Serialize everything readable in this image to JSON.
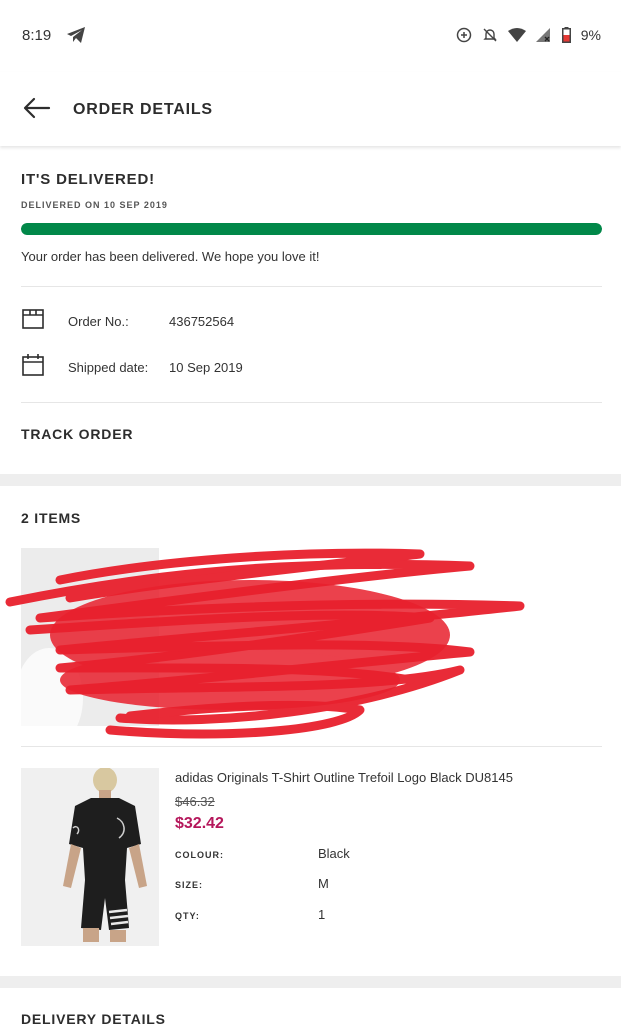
{
  "status_bar": {
    "time": "8:19",
    "battery": "9%",
    "icons": [
      "telegram-send-icon",
      "data-saver-icon",
      "notifications-off-icon",
      "wifi-icon",
      "signal-icon",
      "battery-low-icon"
    ],
    "battery_color": "#e53935"
  },
  "header": {
    "title": "ORDER DETAILS",
    "back_icon": "arrow-left-icon"
  },
  "delivery_status": {
    "title": "IT'S DELIVERED!",
    "subtitle": "DELIVERED ON 10 SEP 2019",
    "progress_fraction": 1.0,
    "progress_color": "#018849",
    "message": "Your order has been delivered. We hope you love it!"
  },
  "order_info": {
    "order_no_label": "Order No.:",
    "order_no_value": "436752564",
    "shipped_label": "Shipped date:",
    "shipped_value": "10 Sep 2019"
  },
  "track_order_label": "TRACK ORDER",
  "items": {
    "title": "2 ITEMS",
    "list": [
      {
        "redacted": true
      },
      {
        "name": "adidas Originals T-Shirt Outline Trefoil Logo Black DU8145",
        "old_price": "$46.32",
        "price": "$32.42",
        "price_color": "#b5175b",
        "attributes": [
          {
            "label": "COLOUR:",
            "value": "Black"
          },
          {
            "label": "SIZE:",
            "value": "M"
          },
          {
            "label": "QTY:",
            "value": "1"
          }
        ]
      }
    ]
  },
  "delivery_details_title": "DELIVERY DETAILS"
}
